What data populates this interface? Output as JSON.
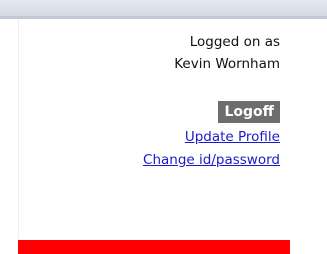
{
  "session": {
    "logged_on_label": "Logged on as",
    "user_name": "Kevin Wornham"
  },
  "actions": {
    "logoff_label": "Logoff",
    "update_profile_label": "Update Profile",
    "change_id_password_label": "Change id/password"
  },
  "colors": {
    "logoff_bg": "#6d6d6d",
    "link": "#1a1acc",
    "red_bar": "#ff0000"
  }
}
